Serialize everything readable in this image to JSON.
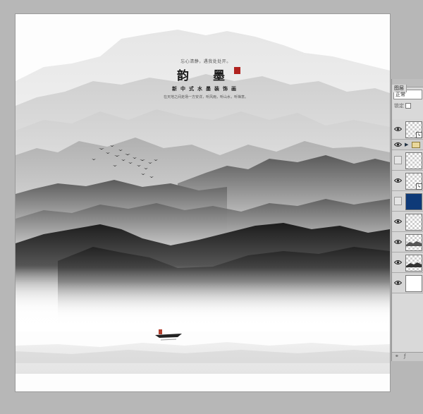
{
  "artwork": {
    "tagline": "忘心清静，遇我处处开。",
    "title": "韵 墨",
    "subtitle": "新中式水墨装饰画",
    "subline": "在天地之间走场一方安详，听风雨，听山水，听禅意。"
  },
  "layers_panel": {
    "tab_label": "图层",
    "blend_mode": "正常",
    "lock_label": "锁定",
    "colors": {
      "fill_layer": "#0e3a78",
      "panel_bg": "#d9d9d9"
    },
    "layers": [
      {
        "kind": "smart-object",
        "visible": true
      },
      {
        "kind": "group",
        "visible": true
      },
      {
        "kind": "transparent",
        "visible": false
      },
      {
        "kind": "smart-object",
        "visible": true
      },
      {
        "kind": "solid-fill",
        "visible": false
      },
      {
        "kind": "transparent",
        "visible": true
      },
      {
        "kind": "mountain",
        "visible": true
      },
      {
        "kind": "mountain",
        "visible": true
      },
      {
        "kind": "white",
        "visible": true
      }
    ]
  }
}
